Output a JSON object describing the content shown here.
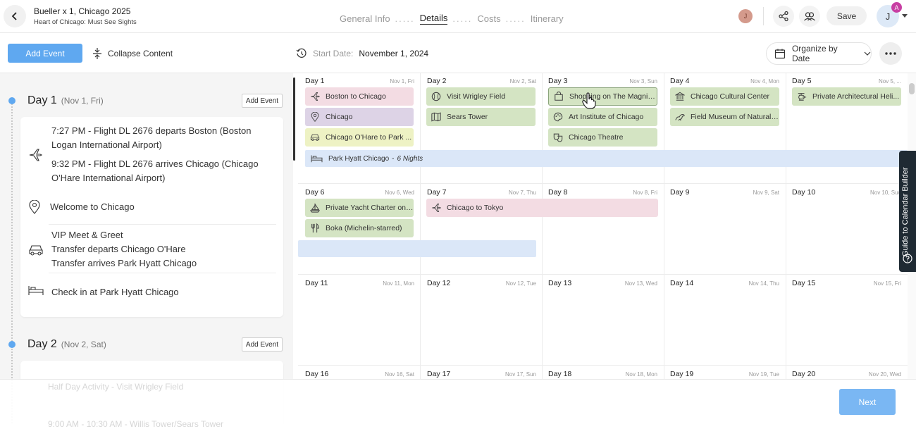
{
  "header": {
    "trip_title": "Bueller x 1, Chicago 2025",
    "trip_subtitle": "Heart of Chicago: Must See Sights",
    "steps": [
      {
        "label": "General Info",
        "active": false
      },
      {
        "label": "Details",
        "active": true
      },
      {
        "label": "Costs",
        "active": false
      },
      {
        "label": "Itinerary",
        "active": false
      }
    ],
    "step_separator": ".....",
    "collaborator_initial": "J",
    "save_label": "Save",
    "user_initial": "J",
    "user_badge": "A"
  },
  "toolbar": {
    "add_event_label": "Add Event",
    "collapse_label": "Collapse Content",
    "start_date_label": "Start Date:",
    "start_date_value": "November 1, 2024",
    "organize_label": "Organize by Date"
  },
  "left_panel": {
    "days": [
      {
        "title": "Day 1",
        "sub": "(Nov 1, Fri)",
        "add_label": "Add Event",
        "events": [
          {
            "icon": "plane-icon",
            "lines": [
              "7:27 PM - Flight DL 2676 departs Boston (Boston Logan International Airport)",
              "9:32 PM - Flight DL 2676 arrives Chicago (Chicago O'Hare International Airport)"
            ]
          },
          {
            "icon": "location-pin-icon",
            "lines": [
              "Welcome to Chicago"
            ]
          },
          {
            "icon": "car-icon",
            "lines": [
              "VIP Meet & Greet",
              "Transfer departs Chicago O'Hare",
              "Transfer arrives Park Hyatt Chicago"
            ]
          },
          {
            "icon": "bed-icon",
            "lines": [
              "Check in at Park Hyatt Chicago"
            ]
          }
        ]
      },
      {
        "title": "Day 2",
        "sub": "(Nov 2, Sat)",
        "add_label": "Add Event",
        "events": [
          {
            "icon": "activity-icon",
            "lines": [
              "Half Day Activity - Visit Wrigley Field"
            ]
          },
          {
            "icon": "car-icon",
            "lines": [
              "9:00 AM - 10:30 AM - Willis Tower/Sears Tower"
            ]
          }
        ]
      }
    ]
  },
  "calendar": {
    "weeks": [
      [
        {
          "day": "Day 1",
          "date": "Nov 1, Fri"
        },
        {
          "day": "Day 2",
          "date": "Nov 2, Sat"
        },
        {
          "day": "Day 3",
          "date": "Nov 3, Sun"
        },
        {
          "day": "Day 4",
          "date": "Nov 4, Mon"
        },
        {
          "day": "Day 5",
          "date": "Nov 5, ..."
        }
      ],
      [
        {
          "day": "Day 6",
          "date": "Nov 6, Wed"
        },
        {
          "day": "Day 7",
          "date": "Nov 7, Thu"
        },
        {
          "day": "Day 8",
          "date": "Nov 8, Fri"
        },
        {
          "day": "Day 9",
          "date": "Nov 9, Sat"
        },
        {
          "day": "Day 10",
          "date": "Nov 10, Sun"
        }
      ],
      [
        {
          "day": "Day 11",
          "date": "Nov 11, Mon"
        },
        {
          "day": "Day 12",
          "date": "Nov 12, Tue"
        },
        {
          "day": "Day 13",
          "date": "Nov 13, Wed"
        },
        {
          "day": "Day 14",
          "date": "Nov 14, Thu"
        },
        {
          "day": "Day 15",
          "date": "Nov 15, Fri"
        }
      ],
      [
        {
          "day": "Day 16",
          "date": "Nov 16, Sat"
        },
        {
          "day": "Day 17",
          "date": "Nov 17, Sun"
        },
        {
          "day": "Day 18",
          "date": "Nov 18, Mon"
        },
        {
          "day": "Day 19",
          "date": "Nov 19, Tue"
        },
        {
          "day": "Day 20",
          "date": "Nov 20, Wed"
        }
      ]
    ],
    "events": {
      "boston_to_chicago": "Boston to Chicago",
      "chicago": "Chicago",
      "ohare_to_park": "Chicago O'Hare to Park ...",
      "wrigley": "Visit Wrigley Field",
      "sears": "Sears Tower",
      "shopping": "Shopping on The Magnific...",
      "art_institute": "Art Institute of Chicago",
      "chicago_theatre": "Chicago Theatre",
      "cultural_center": "Chicago Cultural Center",
      "field_museum": "Field Museum of Natural ...",
      "architectural": "Private Architectural Heli...",
      "yacht": "Private Yacht Charter on ...",
      "boka": "Boka (Michelin-starred)",
      "chicago_to_tokyo": "Chicago to Tokyo"
    },
    "hotel": {
      "name": "Park Hyatt Chicago",
      "nights": "6 Nights",
      "dash": "-"
    }
  },
  "guide_label": "Guide to Calendar Builder",
  "footer": {
    "next_label": "Next"
  }
}
